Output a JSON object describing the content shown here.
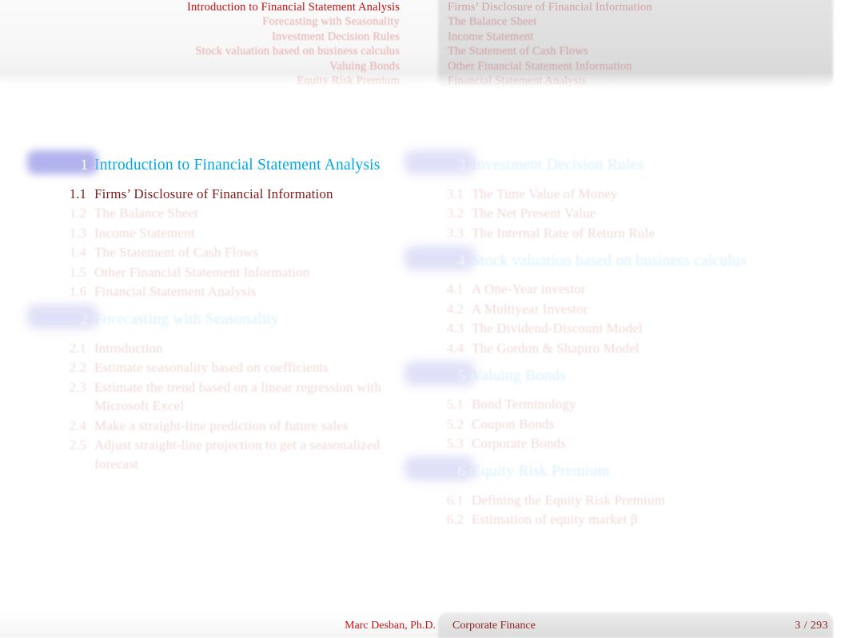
{
  "colors": {
    "accent_blue": "#00a6e6",
    "active_red": "#7d1b1b",
    "header_red": "#c21010",
    "inactive_pink": "#f0d6d6",
    "badge_lavender": "#b2b2ee",
    "footer_red": "#c01818"
  },
  "header": {
    "sections": [
      {
        "label": "Introduction to Financial Statement Analysis",
        "active": true
      },
      {
        "label": "Forecasting with Seasonality",
        "active": false
      },
      {
        "label": "Investment Decision Rules",
        "active": false
      },
      {
        "label": "Stock valuation based on business calculus",
        "active": false
      },
      {
        "label": "Valuing Bonds",
        "active": false
      },
      {
        "label": "Equity Risk Premium",
        "active": false
      }
    ],
    "subsections": [
      {
        "label": "Firms’ Disclosure of Financial Information",
        "active": true
      },
      {
        "label": "The Balance Sheet",
        "active": false
      },
      {
        "label": "Income Statement",
        "active": false
      },
      {
        "label": "The Statement of Cash Flows",
        "active": false
      },
      {
        "label": "Other Financial Statement Information",
        "active": false
      },
      {
        "label": "Financial Statement Analysis",
        "active": false
      }
    ]
  },
  "toc": {
    "left_column": [
      {
        "number": "1",
        "title": "Introduction to Financial Statement Analysis",
        "current": true,
        "items": [
          {
            "num": "1.1",
            "label": "Firms’ Disclosure of Financial Information",
            "current": true
          },
          {
            "num": "1.2",
            "label": "The Balance Sheet",
            "current": false
          },
          {
            "num": "1.3",
            "label": "Income Statement",
            "current": false
          },
          {
            "num": "1.4",
            "label": "The Statement of Cash Flows",
            "current": false
          },
          {
            "num": "1.5",
            "label": "Other Financial Statement Information",
            "current": false
          },
          {
            "num": "1.6",
            "label": "Financial Statement Analysis",
            "current": false
          }
        ]
      },
      {
        "number": "2",
        "title": "Forecasting with Seasonality",
        "current": false,
        "items": [
          {
            "num": "2.1",
            "label": "Introduction",
            "current": false
          },
          {
            "num": "2.2",
            "label": "Estimate seasonality based on coefficients",
            "current": false
          },
          {
            "num": "2.3",
            "label": "Estimate the trend based on a linear regression with Microsoft Excel",
            "current": false
          },
          {
            "num": "2.4",
            "label": "Make a straight-line prediction of future sales",
            "current": false
          },
          {
            "num": "2.5",
            "label": "Adjust straight-line projection to get a seasonalized forecast",
            "current": false
          }
        ]
      }
    ],
    "right_column": [
      {
        "number": "3",
        "title": "Investment Decision Rules",
        "current": false,
        "items": [
          {
            "num": "3.1",
            "label": "The Time Value of Money",
            "current": false
          },
          {
            "num": "3.2",
            "label": "The Net Present Value",
            "current": false
          },
          {
            "num": "3.3",
            "label": "The Internal Rate of Return Rule",
            "current": false
          }
        ]
      },
      {
        "number": "4",
        "title": "Stock valuation based on business calculus",
        "current": false,
        "items": [
          {
            "num": "4.1",
            "label": "A One-Year investor",
            "current": false
          },
          {
            "num": "4.2",
            "label": "A Multiyear Investor",
            "current": false
          },
          {
            "num": "4.3",
            "label": "The Dividend-Discount Model",
            "current": false
          },
          {
            "num": "4.4",
            "label": "The Gordon & Shapiro Model",
            "current": false
          }
        ]
      },
      {
        "number": "5",
        "title": "Valuing Bonds",
        "current": false,
        "items": [
          {
            "num": "5.1",
            "label": "Bond Terminology",
            "current": false
          },
          {
            "num": "5.2",
            "label": "Coupon Bonds",
            "current": false
          },
          {
            "num": "5.3",
            "label": "Corporate Bonds",
            "current": false
          }
        ]
      },
      {
        "number": "6",
        "title": "Equity Risk Premium",
        "current": false,
        "items": [
          {
            "num": "6.1",
            "label": "Defining the Equity Risk Premium",
            "current": false
          },
          {
            "num": "6.2",
            "label": "Estimation of equity market   β",
            "current": false
          }
        ]
      }
    ]
  },
  "footer": {
    "author": "Marc Desban, Ph.D.",
    "title": "Corporate Finance",
    "page": "3 / 293"
  }
}
